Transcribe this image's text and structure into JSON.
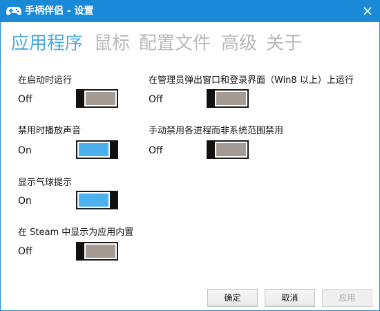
{
  "window": {
    "title": "手柄伴侣 - 设置"
  },
  "tabs": [
    {
      "label": "应用程序",
      "active": true
    },
    {
      "label": "鼠标",
      "active": false
    },
    {
      "label": "配置文件",
      "active": false
    },
    {
      "label": "高级",
      "active": false
    },
    {
      "label": "关于",
      "active": false
    }
  ],
  "settings": {
    "run_at_startup": {
      "label": "在启动时运行",
      "state": "Off"
    },
    "run_on_admin": {
      "label": "在管理员弹出窗口和登录界面（Win8 以上）上运行",
      "state": "Off"
    },
    "play_sound_on_disable": {
      "label": "禁用时播放声音",
      "state": "On"
    },
    "manual_disable": {
      "label": "手动禁用各进程而非系统范围禁用",
      "state": "Off"
    },
    "show_balloon": {
      "label": "显示气球提示",
      "state": "On"
    },
    "steam_overlay": {
      "label": "在 Steam 中显示为应用内置",
      "state": "Off"
    }
  },
  "buttons": {
    "ok": "确定",
    "cancel": "取消",
    "apply": "应用"
  },
  "colors": {
    "titlebar": "#1a8ad8",
    "active_tab": "#4aa8e0",
    "inactive_tab": "#b9b9b9",
    "toggle_on": "#4cb0ec",
    "toggle_off": "#a49c94"
  },
  "icons": {
    "app": "gamepad-icon",
    "close": "close-icon"
  }
}
